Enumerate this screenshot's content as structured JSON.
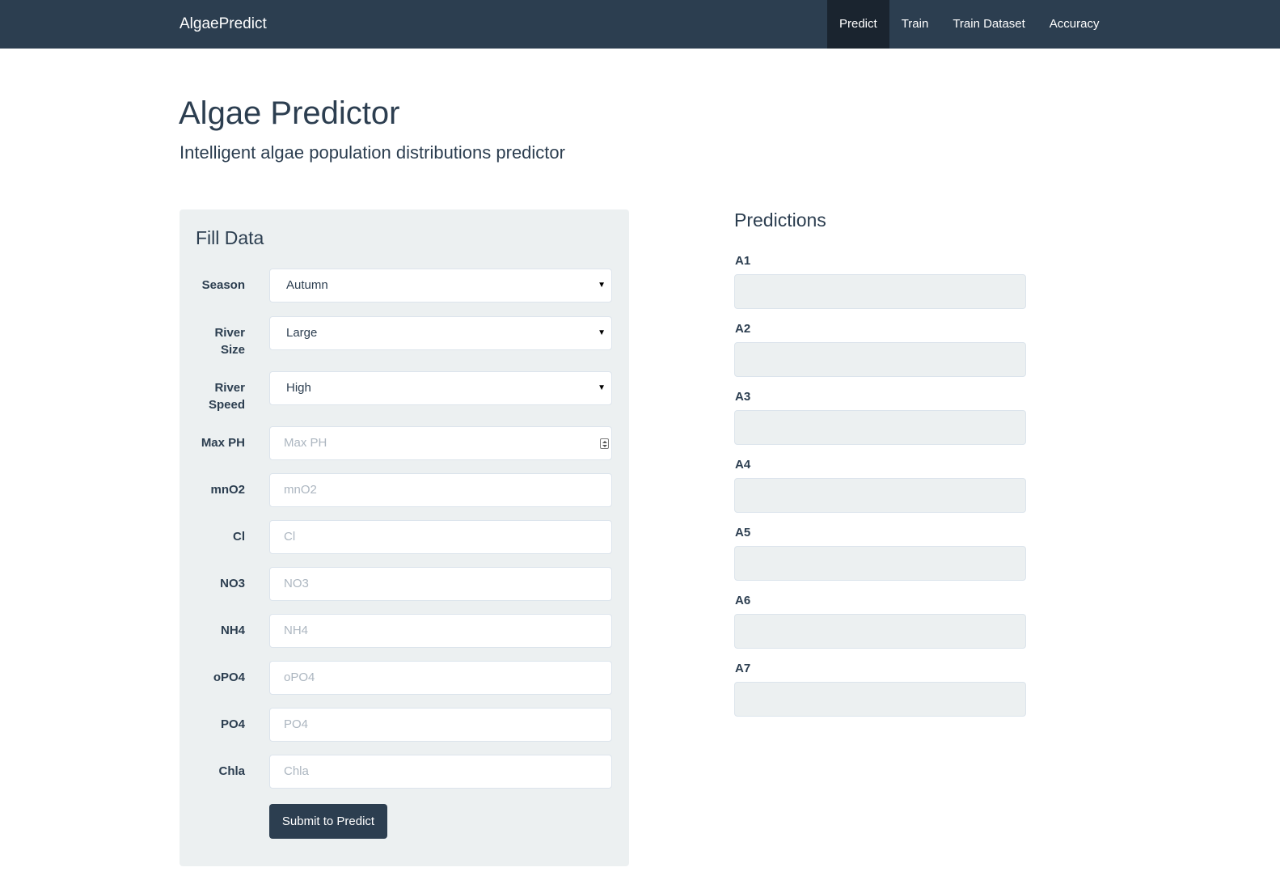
{
  "navbar": {
    "brand": "AlgaePredict",
    "items": [
      {
        "label": "Predict",
        "active": true
      },
      {
        "label": "Train",
        "active": false
      },
      {
        "label": "Train Dataset",
        "active": false
      },
      {
        "label": "Accuracy",
        "active": false
      }
    ]
  },
  "header": {
    "title": "Algae Predictor",
    "subtitle": "Intelligent algae population distributions predictor"
  },
  "form": {
    "title": "Fill Data",
    "season": {
      "label": "Season",
      "value": "Autumn"
    },
    "river_size": {
      "label_line1": "River",
      "label_line2": "Size",
      "value": "Large"
    },
    "river_speed": {
      "label_line1": "River",
      "label_line2": "Speed",
      "value": "High"
    },
    "max_ph": {
      "label": "Max PH",
      "placeholder": "Max PH"
    },
    "mno2": {
      "label": "mnO2",
      "placeholder": "mnO2"
    },
    "cl": {
      "label": "Cl",
      "placeholder": "Cl"
    },
    "no3": {
      "label": "NO3",
      "placeholder": "NO3"
    },
    "nh4": {
      "label": "NH4",
      "placeholder": "NH4"
    },
    "opo4": {
      "label": "oPO4",
      "placeholder": "oPO4"
    },
    "po4": {
      "label": "PO4",
      "placeholder": "PO4"
    },
    "chla": {
      "label": "Chla",
      "placeholder": "Chla"
    },
    "submit_label": "Submit to Predict"
  },
  "predictions": {
    "title": "Predictions",
    "a1": {
      "label": "A1",
      "value": ""
    },
    "a2": {
      "label": "A2",
      "value": ""
    },
    "a3": {
      "label": "A3",
      "value": ""
    },
    "a4": {
      "label": "A4",
      "value": ""
    },
    "a5": {
      "label": "A5",
      "value": ""
    },
    "a6": {
      "label": "A6",
      "value": ""
    },
    "a7": {
      "label": "A7",
      "value": ""
    }
  },
  "colors": {
    "navbar": "#2c3e50",
    "navbar_active": "#1a242f",
    "panel": "#ecf0f1",
    "button": "#2c3e50"
  }
}
